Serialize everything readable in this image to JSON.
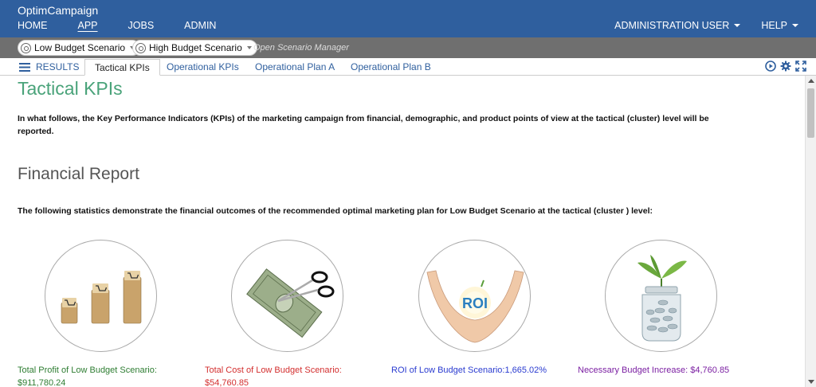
{
  "app": {
    "brand": "OptimCampaign"
  },
  "nav": {
    "items": [
      "HOME",
      "APP",
      "JOBS",
      "ADMIN"
    ],
    "user_menu": "ADMINISTRATION USER",
    "help_menu": "HELP"
  },
  "scenarios": {
    "low": "Low Budget Scenario",
    "high": "High Budget Scenario",
    "manager": "Open Scenario Manager"
  },
  "tabs": {
    "results": "RESULTS",
    "items": [
      "Tactical KPIs",
      "Operational KPIs",
      "Operational Plan A",
      "Operational Plan B"
    ],
    "active": "Tactical KPIs"
  },
  "content": {
    "title": "Tactical KPIs",
    "intro": "In what follows, the Key Performance Indicators (KPIs) of the marketing campaign from financial, demographic, and product points of view at the tactical (cluster) level will be reported.",
    "financial_heading": "Financial Report",
    "financial_lead": "The following statistics demonstrate the financial outcomes of the recommended optimal marketing plan for Low Budget Scenario at the tactical (cluster ) level:",
    "roi_badge": "ROI",
    "metrics": {
      "profit_label": "Total Profit of Low Budget Scenario:",
      "profit_value": "$911,780.24",
      "cost_label": "Total Cost of Low Budget Scenario:",
      "cost_value": "$54,760.85",
      "roi": "ROI of Low Budget Scenario:1,665.02%",
      "budget": "Necessary Budget Increase: $4,760.85"
    }
  },
  "colors": {
    "nav_bg": "#2f5f9e",
    "title_green": "#4aa37a",
    "profit_green": "#2e7d32",
    "cost_red": "#d32f2f",
    "roi_blue": "#2a3bd0",
    "budget_purple": "#7b1fa2"
  }
}
